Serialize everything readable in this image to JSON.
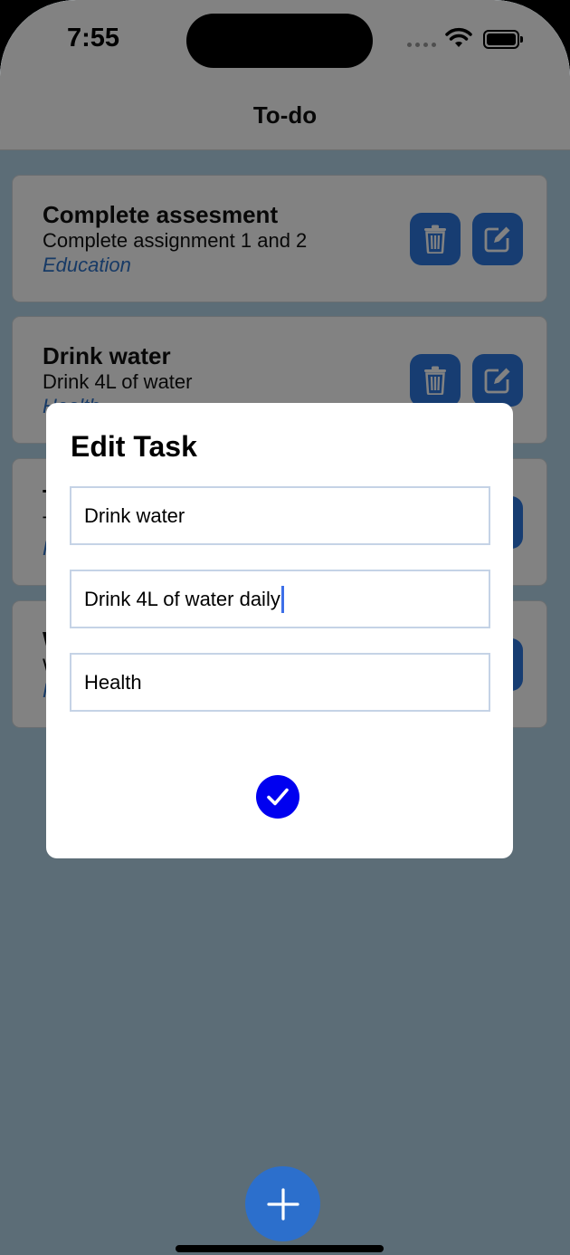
{
  "status_bar": {
    "time": "7:55"
  },
  "header": {
    "title": "To-do"
  },
  "tasks": [
    {
      "title": "Complete assesment",
      "description": "Complete assignment 1 and 2",
      "category": "Education"
    },
    {
      "title": "Drink water",
      "description": "Drink 4L of water",
      "category": "Health"
    },
    {
      "title": "T",
      "description": "T",
      "category": "H"
    },
    {
      "title": "W",
      "description": "W",
      "category": "H"
    }
  ],
  "modal": {
    "title": "Edit Task",
    "fields": [
      {
        "value": "Drink water"
      },
      {
        "value": "Drink 4L of water daily"
      },
      {
        "value": "Health"
      }
    ]
  },
  "colors": {
    "accent": "#2d79e0",
    "confirm": "#0000f0",
    "category_text": "#2e73c9",
    "background": "#b4d6e9"
  },
  "icons": {
    "delete": "trash-icon",
    "edit": "edit-icon",
    "confirm": "checkmark-icon",
    "add": "plus-icon"
  }
}
